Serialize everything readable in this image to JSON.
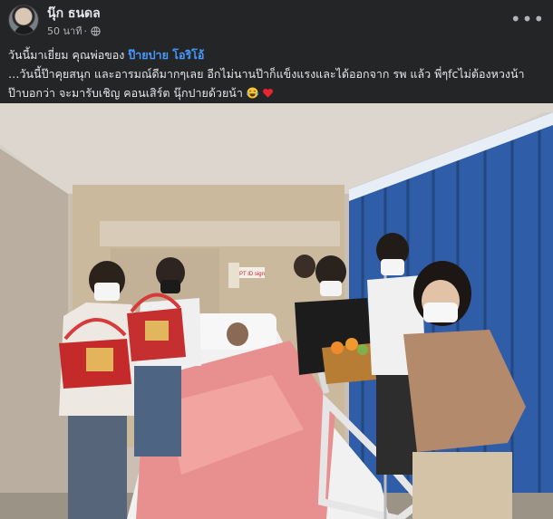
{
  "post": {
    "author": "นุ๊ก ธนดล",
    "timestamp": "50 นาที",
    "privacy_icon": "globe-icon",
    "more_icon": "more-options-icon",
    "line1_prefix": "วันนี้มาเยี่ยม คุณพ่อของ ",
    "mention": "ป๊ายปาย โอริโอ้",
    "line2": "…วันนี้ป๊าคุยสนุก และอารมณ์ดีมากๆเลย อีกไม่นานป๊าก็แข็งแรงและได้ออกจาก รพ แล้ว พี่ๆfcไม่ต้องหวงน้า",
    "line3": "ป๊าบอกว่า จะมารับเชิญ คอนเสิร์ต นุ๊กปายด้วยน้า",
    "emoji_1": "laughing-crying-emoji",
    "emoji_2": "red-heart-emoji",
    "photo": {
      "description_icon": "hospital-visit-photo",
      "sign_text": "PT ID sign"
    }
  },
  "colors": {
    "background": "#242526",
    "text": "#e4e6eb",
    "secondary_text": "#b0b3b8",
    "mention": "#4599ff"
  }
}
